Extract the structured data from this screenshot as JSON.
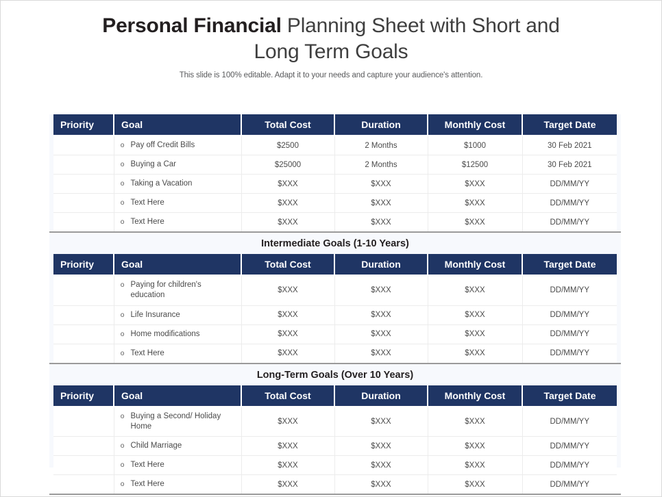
{
  "title": {
    "strong": "Personal Financial",
    "rest": " Planning Sheet with Short and",
    "line2": "Long Term Goals",
    "subtitle": "This slide is 100% editable. Adapt it to your needs and capture your audience's attention."
  },
  "colors": {
    "header_navy": "#1F3564",
    "panel_background": "#F7F9FD",
    "body_text": "#4A4A4A",
    "section_title": "#231F20",
    "row_divider": "#ECECEC",
    "table_bottom_rule": "#9A9A9A"
  },
  "columns": [
    "Priority",
    "Goal",
    "Total Cost",
    "Duration",
    "Monthly Cost",
    "Target Date"
  ],
  "bullet_glyph": "o",
  "tables": [
    {
      "section_title": "",
      "headers": [
        "Priority",
        "Goal",
        "Total Cost",
        "Duration",
        "Monthly Cost",
        "Target Date"
      ],
      "rows": [
        {
          "priority": "",
          "goal": "Pay off Credit Bills",
          "total_cost": "$2500",
          "duration": "2 Months",
          "monthly_cost": "$1000",
          "target_date": "30 Feb 2021"
        },
        {
          "priority": "",
          "goal": "Buying a Car",
          "total_cost": "$25000",
          "duration": "2 Months",
          "monthly_cost": "$12500",
          "target_date": "30 Feb 2021"
        },
        {
          "priority": "",
          "goal": "Taking a Vacation",
          "total_cost": "$XXX",
          "duration": "$XXX",
          "monthly_cost": "$XXX",
          "target_date": "DD/MM/YY"
        },
        {
          "priority": "",
          "goal": "Text Here",
          "total_cost": "$XXX",
          "duration": "$XXX",
          "monthly_cost": "$XXX",
          "target_date": "DD/MM/YY"
        },
        {
          "priority": "",
          "goal": "Text Here",
          "total_cost": "$XXX",
          "duration": "$XXX",
          "monthly_cost": "$XXX",
          "target_date": "DD/MM/YY"
        }
      ]
    },
    {
      "section_title": "Intermediate Goals (1-10 Years)",
      "headers": [
        "Priority",
        "Goal",
        "Total Cost",
        "Duration",
        "Monthly Cost",
        "Target Date"
      ],
      "rows": [
        {
          "priority": "",
          "goal": "Paying for children's education",
          "total_cost": "$XXX",
          "duration": "$XXX",
          "monthly_cost": "$XXX",
          "target_date": "DD/MM/YY"
        },
        {
          "priority": "",
          "goal": "Life Insurance",
          "total_cost": "$XXX",
          "duration": "$XXX",
          "monthly_cost": "$XXX",
          "target_date": "DD/MM/YY"
        },
        {
          "priority": "",
          "goal": "Home modifications",
          "total_cost": "$XXX",
          "duration": "$XXX",
          "monthly_cost": "$XXX",
          "target_date": "DD/MM/YY"
        },
        {
          "priority": "",
          "goal": "Text Here",
          "total_cost": "$XXX",
          "duration": "$XXX",
          "monthly_cost": "$XXX",
          "target_date": "DD/MM/YY"
        }
      ]
    },
    {
      "section_title": "Long-Term Goals (Over 10 Years)",
      "headers": [
        "Priority",
        "Goal",
        "Total Cost",
        "Duration",
        "Monthly Cost",
        "Target Date"
      ],
      "rows": [
        {
          "priority": "",
          "goal": "Buying a Second/ Holiday Home",
          "total_cost": "$XXX",
          "duration": "$XXX",
          "monthly_cost": "$XXX",
          "target_date": "DD/MM/YY"
        },
        {
          "priority": "",
          "goal": "Child Marriage",
          "total_cost": "$XXX",
          "duration": "$XXX",
          "monthly_cost": "$XXX",
          "target_date": "DD/MM/YY"
        },
        {
          "priority": "",
          "goal": "Text Here",
          "total_cost": "$XXX",
          "duration": "$XXX",
          "monthly_cost": "$XXX",
          "target_date": "DD/MM/YY"
        },
        {
          "priority": "",
          "goal": "Text Here",
          "total_cost": "$XXX",
          "duration": "$XXX",
          "monthly_cost": "$XXX",
          "target_date": "DD/MM/YY"
        }
      ]
    }
  ]
}
